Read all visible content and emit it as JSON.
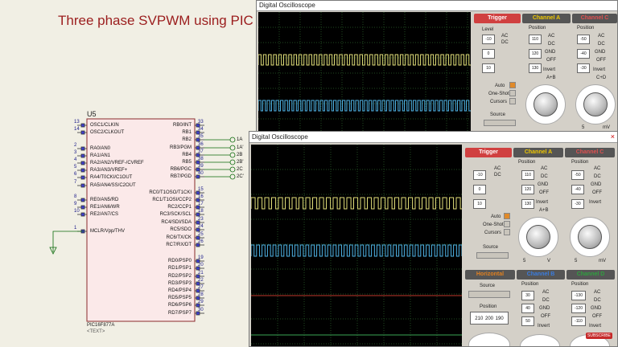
{
  "schematic": {
    "title": "Three phase SVPWM using PIC",
    "chip_ref": "U5",
    "chip_part": "PIC16F877A",
    "chip_text": "<TEXT>",
    "left_pins": [
      {
        "num": "13",
        "name": "OSC1/CLKIN"
      },
      {
        "num": "14",
        "name": "OSC2/CLKOUT"
      },
      {
        "num": "2",
        "name": "RA0/AN0"
      },
      {
        "num": "3",
        "name": "RA1/AN1"
      },
      {
        "num": "4",
        "name": "RA2/AN2/VREF-/CVREF"
      },
      {
        "num": "5",
        "name": "RA3/AN3/VREF+"
      },
      {
        "num": "6",
        "name": "RA4/T0CKI/C1OUT"
      },
      {
        "num": "7",
        "name": "RA5/AN4/SS/C2OUT"
      },
      {
        "num": "8",
        "name": "RE0/AN5/RD"
      },
      {
        "num": "9",
        "name": "RE1/AN6/WR"
      },
      {
        "num": "10",
        "name": "RE2/AN7/CS"
      },
      {
        "num": "1",
        "name": "MCLR/Vpp/THV"
      }
    ],
    "right_pins": [
      {
        "num": "33",
        "name": "RB0/INT"
      },
      {
        "num": "34",
        "name": "RB1"
      },
      {
        "num": "35",
        "name": "RB2"
      },
      {
        "num": "36",
        "name": "RB3/PGM"
      },
      {
        "num": "37",
        "name": "RB4"
      },
      {
        "num": "38",
        "name": "RB5"
      },
      {
        "num": "39",
        "name": "RB6/PGC"
      },
      {
        "num": "40",
        "name": "RB7/PGD"
      },
      {
        "num": "15",
        "name": "RC0/T1OSO/T1CKI"
      },
      {
        "num": "16",
        "name": "RC1/T1OSI/CCP2"
      },
      {
        "num": "17",
        "name": "RC2/CCP1"
      },
      {
        "num": "18",
        "name": "RC3/SCK/SCL"
      },
      {
        "num": "23",
        "name": "RC4/SDI/SDA"
      },
      {
        "num": "24",
        "name": "RC5/SDO"
      },
      {
        "num": "25",
        "name": "RC6/TX/CK"
      },
      {
        "num": "26",
        "name": "RC7/RX/DT"
      },
      {
        "num": "19",
        "name": "RD0/PSP0"
      },
      {
        "num": "20",
        "name": "RD1/PSP1"
      },
      {
        "num": "21",
        "name": "RD2/PSP2"
      },
      {
        "num": "22",
        "name": "RD3/PSP3"
      },
      {
        "num": "27",
        "name": "RD4/PSP4"
      },
      {
        "num": "28",
        "name": "RD5/PSP5"
      },
      {
        "num": "29",
        "name": "RD6/PSP6"
      },
      {
        "num": "30",
        "name": "RD7/PSP7"
      }
    ],
    "terminals": [
      "1A",
      "1A'",
      "2B",
      "2B'",
      "2C",
      "2C'"
    ]
  },
  "scope1": {
    "title": "Digital Oscilloscope",
    "trigger": {
      "head": "Trigger",
      "level": "Level",
      "values": [
        "-10",
        "0",
        "10"
      ],
      "ac": "AC",
      "dc": "DC",
      "auto": "Auto",
      "one_shot": "One-Shot",
      "cursors": "Cursors",
      "source": "Source"
    },
    "ch_a": {
      "head": "Channel A",
      "position": "Position",
      "values": [
        "110",
        "120",
        "130"
      ],
      "ac": "AC",
      "dc": "DC",
      "gnd": "GND",
      "off": "OFF",
      "invert": "Invert",
      "ab": "A+B"
    },
    "ch_c": {
      "head": "Channel C",
      "position": "Position",
      "values": [
        "-50",
        "-40",
        "-30"
      ],
      "ac": "AC",
      "dc": "DC",
      "gnd": "GND",
      "off": "OFF",
      "invert": "Invert",
      "cd": "C+D",
      "volts": "5",
      "unit": "mV"
    }
  },
  "scope2": {
    "title": "Digital Oscilloscope",
    "close": "×",
    "trigger": {
      "head": "Trigger",
      "values": [
        "-10",
        "0",
        "10"
      ],
      "ac": "AC",
      "dc": "DC",
      "auto": "Auto",
      "one_shot": "One-Shot",
      "cursors": "Cursors",
      "source": "Source"
    },
    "ch_a": {
      "head": "Channel A",
      "position": "Position",
      "values": [
        "110",
        "120",
        "130"
      ],
      "ac": "AC",
      "dc": "DC",
      "gnd": "GND",
      "off": "OFF",
      "invert": "Invert",
      "ab": "A+B",
      "volts": "5",
      "unit": "V"
    },
    "ch_c": {
      "head": "Channel C",
      "position": "Position",
      "values": [
        "-50",
        "-40",
        "-30"
      ],
      "ac": "AC",
      "dc": "DC",
      "gnd": "GND",
      "off": "OFF",
      "invert": "Invert",
      "volts": "5",
      "unit": "mV"
    },
    "horizontal": {
      "head": "Horizontal",
      "source": "Source",
      "position": "Position",
      "values": [
        "210",
        "200",
        "190"
      ]
    },
    "ch_b": {
      "head": "Channel B",
      "position": "Position",
      "values": [
        "30",
        "40",
        "50"
      ],
      "ac": "AC",
      "dc": "DC",
      "gnd": "GND",
      "off": "OFF",
      "invert": "Invert"
    },
    "ch_d": {
      "head": "Channel D",
      "position": "Position",
      "values": [
        "-130",
        "-120",
        "-110"
      ],
      "ac": "AC",
      "dc": "DC",
      "gnd": "GND",
      "off": "OFF",
      "invert": "Invert"
    }
  },
  "badge": "SUBSCRIBE",
  "colors": {
    "trace_a": "#e3e07a",
    "trace_b": "#4fb3e6",
    "trace_c": "#c0392b",
    "trace_d": "#3aa655",
    "trigger": "#c0392b",
    "channel_a": "#f0c800",
    "channel_b": "#3a7de0",
    "channel_c": "#d04040",
    "channel_d": "#30a040",
    "horizontal": "#e08020"
  }
}
